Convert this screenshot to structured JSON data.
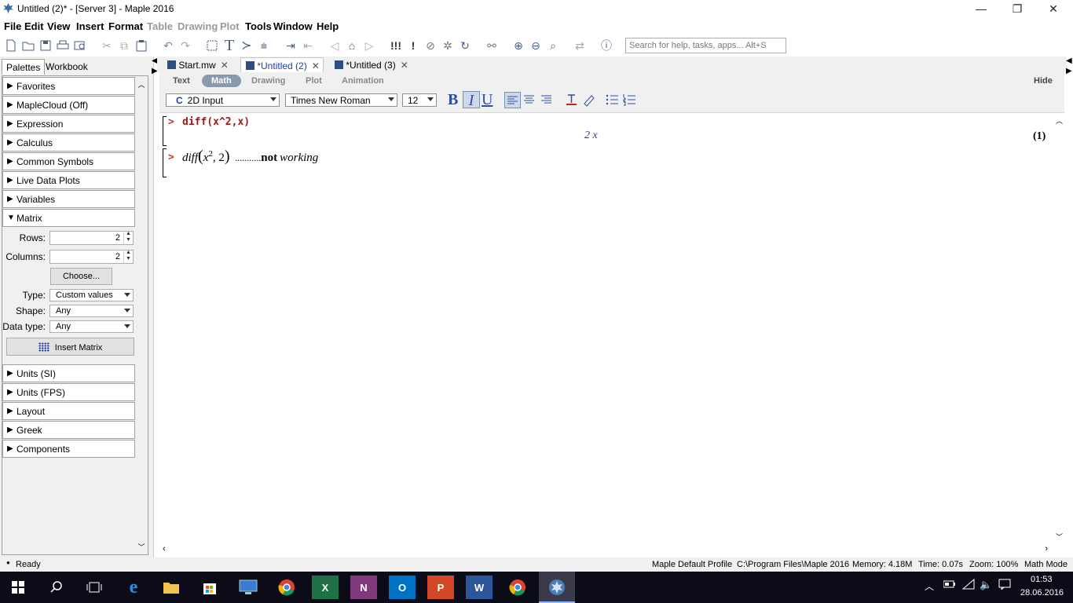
{
  "window": {
    "title": "Untitled (2)* - [Server 3] - Maple 2016",
    "minimize": "—",
    "maximize": "❐",
    "close": "✕"
  },
  "menu": {
    "items": [
      "File",
      "Edit",
      "View",
      "Insert",
      "Format",
      "Table",
      "Drawing",
      "Plot",
      "Tools",
      "Window",
      "Help"
    ],
    "disabled": [
      "Table",
      "Drawing",
      "Plot"
    ]
  },
  "toolbar": {
    "search_placeholder": "Search for help, tasks, apps... Alt+S",
    "exclaim_triple": "!!!",
    "exclaim_single": "!"
  },
  "left_pane": {
    "tabs": [
      "Palettes",
      "Workbook"
    ],
    "sections_top": [
      "Favorites",
      "MapleCloud (Off)",
      "Expression",
      "Calculus",
      "Common Symbols",
      "Live Data Plots",
      "Variables"
    ],
    "matrix_section": "Matrix",
    "matrix": {
      "rows_label": "Rows:",
      "rows_value": "2",
      "columns_label": "Columns:",
      "columns_value": "2",
      "choose_button": "Choose...",
      "type_label": "Type:",
      "type_value": "Custom values",
      "shape_label": "Shape:",
      "shape_value": "Any",
      "datatype_label": "Data type:",
      "datatype_value": "Any",
      "insert_button": "Insert Matrix"
    },
    "sections_bottom": [
      "Units (SI)",
      "Units (FPS)",
      "Layout",
      "Greek",
      "Components"
    ]
  },
  "doc_tabs": [
    {
      "label": "Start.mw",
      "active": false
    },
    {
      "label": "*Untitled (2)",
      "active": true
    },
    {
      "label": "*Untitled (3)",
      "active": false
    }
  ],
  "context_bar": {
    "modes": [
      "Text",
      "Math",
      "Drawing",
      "Plot",
      "Animation"
    ],
    "active_mode": "Math",
    "hide": "Hide",
    "input_mode": "2D Input",
    "input_mode_icon": "C",
    "font": "Times New Roman",
    "font_size": "12",
    "bold": "B",
    "italic": "I",
    "underline": "U"
  },
  "document": {
    "prompt": ">",
    "line1_input": "diff(x^2,x)",
    "line1_output": "2 x",
    "line1_label": "(1)",
    "line2_func": "diff",
    "line2_base": "x",
    "line2_exp": "2",
    "line2_arg": ", 2",
    "line2_dots": "...........",
    "line2_not": "not",
    "line2_working": "working"
  },
  "status": {
    "ready": "Ready",
    "profile": "Maple Default Profile",
    "path": "C:\\Program Files\\Maple 2016",
    "memory": "Memory: 4.18M",
    "time": "Time: 0.07s",
    "zoom": "Zoom: 100%",
    "mode": "Math Mode"
  },
  "taskbar": {
    "clock_time": "01:53",
    "clock_date": "28.06.2016",
    "apps": [
      "windows-start",
      "search",
      "task-view",
      "edge",
      "file-explorer",
      "store",
      "remote-desktop",
      "chrome",
      "excel",
      "onenote",
      "outlook",
      "powerpoint",
      "word",
      "chrome",
      "maple"
    ],
    "app_letters": {
      "excel": "X",
      "onenote": "N",
      "outlook": "O",
      "powerpoint": "P",
      "word": "W",
      "edge": "e"
    }
  }
}
